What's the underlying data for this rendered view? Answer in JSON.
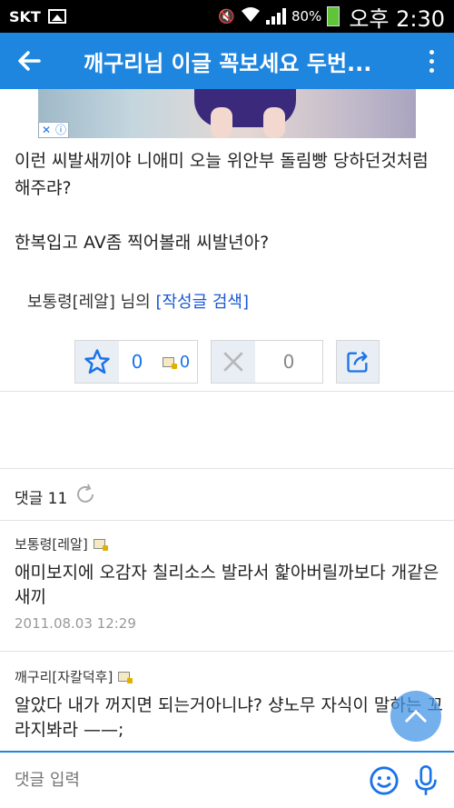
{
  "status": {
    "carrier": "SKT",
    "battery": "80%",
    "time": "오후 2:30"
  },
  "header": {
    "title": "깨구리님 이글 꼭보세요 두번..."
  },
  "article": {
    "paragraphs": [
      "이런 씨발새끼야 니애미 오늘 위안부 돌림빵 당하던것처럼 해주랴?",
      "한복입고 AV좀 찍어볼래 씨발년아?"
    ],
    "author_name": "보통령[레알]",
    "author_suffix": " 님의 ",
    "search_link": "[작성글 검색]"
  },
  "votes": {
    "like_count": "0",
    "lock_count": "0",
    "dislike_count": "0"
  },
  "comments_header": {
    "label": "댓글 11"
  },
  "comments": [
    {
      "author": "보통령[레알]",
      "text": "애미보지에 오감자 칠리소스 발라서 핥아버릴까보다 개같은새끼",
      "date": "2011.08.03 12:29"
    },
    {
      "author": "깨구리[자칼덕후]",
      "text": "알았다 내가 꺼지면 되는거아니냐? 샹노무 자식이 말하는 꼬라지봐라 ——;"
    }
  ],
  "input": {
    "placeholder": "댓글 입력"
  }
}
